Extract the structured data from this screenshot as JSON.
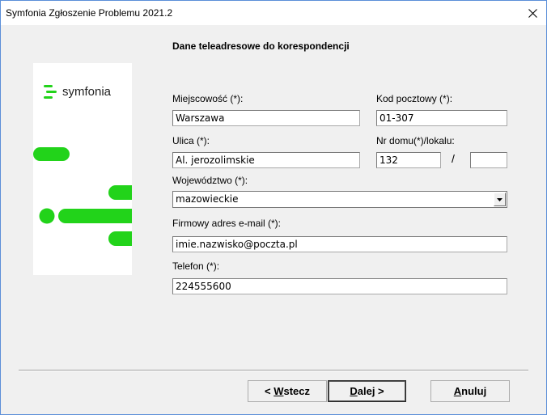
{
  "window": {
    "title": "Symfonia Zgłoszenie Problemu 2021.2"
  },
  "heading": "Dane teleadresowe do korespondencji",
  "logo": {
    "text": "symfonia",
    "accent": "#22d31a"
  },
  "form": {
    "city": {
      "label": "Miejscowość (*):",
      "value": "Warszawa"
    },
    "postal": {
      "label": "Kod pocztowy (*):",
      "value": "01-307"
    },
    "street": {
      "label": "Ulica (*):",
      "value": "Al. jerozolimskie"
    },
    "house": {
      "label": "Nr domu(*)/lokalu:",
      "house_value": "132",
      "separator": "/",
      "apartment_value": ""
    },
    "voivodeship": {
      "label": "Województwo (*):",
      "value": "mazowieckie"
    },
    "email": {
      "label": "Firmowy adres e-mail (*):",
      "value": "imie.nazwisko@poczta.pl"
    },
    "phone": {
      "label": "Telefon (*):",
      "value": "224555600"
    }
  },
  "buttons": {
    "back": {
      "prefix": "< ",
      "mnemonic": "W",
      "rest": "stecz"
    },
    "next": {
      "mnemonic": "D",
      "rest": "alej >"
    },
    "cancel": {
      "mnemonic": "A",
      "rest": "nuluj"
    }
  }
}
